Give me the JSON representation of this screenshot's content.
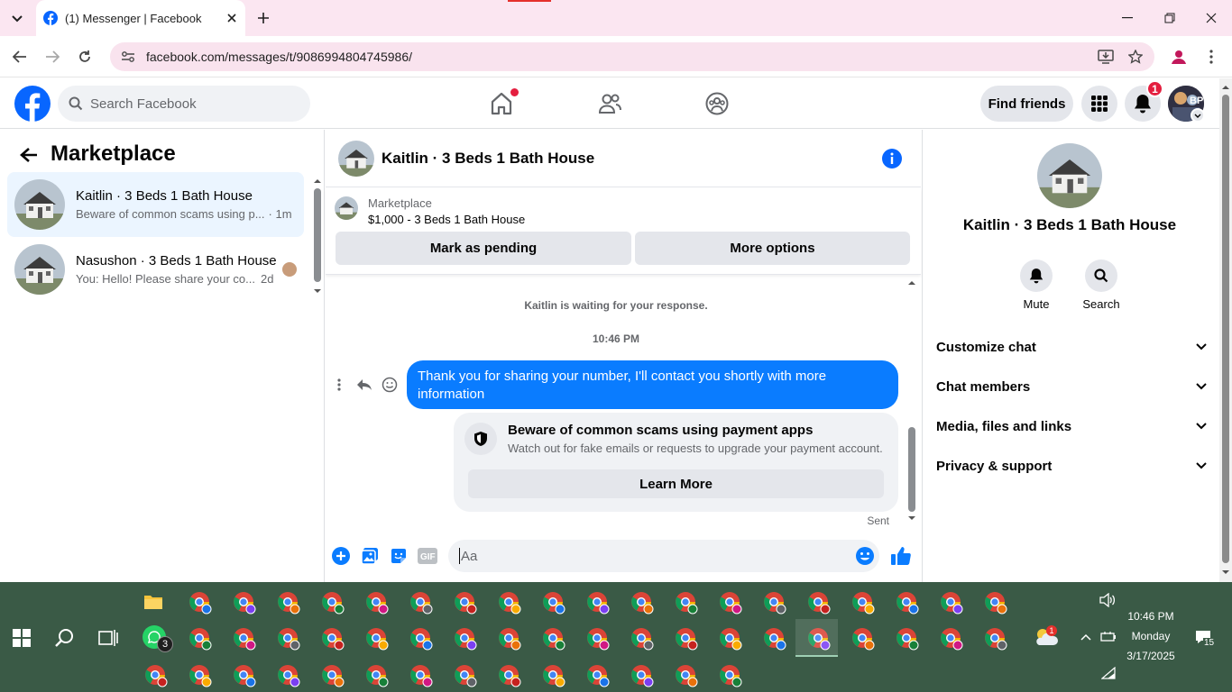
{
  "browser": {
    "tab_title": "(1) Messenger | Facebook",
    "url": "facebook.com/messages/t/9086994804745986/"
  },
  "header": {
    "search_placeholder": "Search Facebook",
    "find_friends": "Find friends",
    "notification_count": "1"
  },
  "sidebar": {
    "title": "Marketplace",
    "conversations": [
      {
        "name": "Kaitlin · 3 Beds 1 Bath House",
        "preview": "Beware of common scams using p...",
        "time": "· 1m"
      },
      {
        "name": "Nasushon · 3 Beds 1 Bath House",
        "preview": "You: Hello! Please share your co...",
        "time": "2d"
      }
    ]
  },
  "chat": {
    "title": "Kaitlin · 3 Beds 1 Bath House",
    "listing_source": "Marketplace",
    "listing_title": "$1,000 - 3 Beds 1 Bath House",
    "mark_pending": "Mark as pending",
    "more_options": "More options",
    "waiting": "Kaitlin is waiting for your response.",
    "timestamp": "10:46 PM",
    "message": "Thank you for sharing your number, I'll contact you shortly with more information",
    "warning_title": "Beware of common scams using payment apps",
    "warning_body": "Watch out for fake emails or requests to upgrade your payment account.",
    "learn_more": "Learn More",
    "sent_label": "Sent",
    "composer_placeholder": "Aa"
  },
  "details": {
    "name": "Kaitlin · 3 Beds 1 Bath House",
    "mute": "Mute",
    "search": "Search",
    "sections": [
      "Customize chat",
      "Chat members",
      "Media, files and links",
      "Privacy & support"
    ]
  },
  "taskbar": {
    "whatsapp_badge": "3",
    "time": "10:46 PM",
    "day": "Monday",
    "date": "3/17/2025",
    "notif_count": "15",
    "weather_badge": "1"
  },
  "colors": {
    "fb_blue": "#0866ff",
    "messenger_blue": "#0a7cff",
    "taskbar": "#3a5a46",
    "tab_strip": "#fbe6f1"
  }
}
